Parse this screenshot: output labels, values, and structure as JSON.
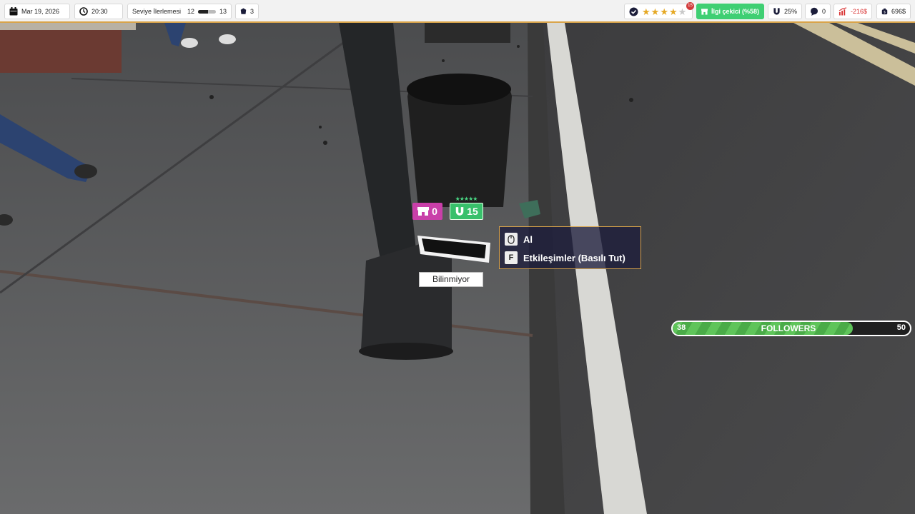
{
  "hud": {
    "date": "Mar 19, 2026",
    "time": "20:30",
    "level_label": "Seviye İlerlemesi",
    "level_current": "12",
    "level_next": "13",
    "level_progress": 0.55,
    "store_count": "3",
    "rating_stars": 4,
    "rating_max": 5,
    "rating_badge": "15",
    "appeal_label": "İlgi çekici (%58)",
    "magnet_pct": "25%",
    "bubble_count": "0",
    "trend_value": "-216$",
    "money": "696$",
    "colors": {
      "accent_gold": "#d9a44a",
      "appeal_green": "#3fcf73",
      "negative": "#d83030"
    }
  },
  "world": {
    "pink_tag_value": "0",
    "green_tag_value": "15",
    "green_tag_stars": "★★★★★",
    "item_label": "Bilinmiyor",
    "prompt": {
      "primary_key_icon": "mouse-icon",
      "primary_action": "Al",
      "secondary_key": "F",
      "secondary_action": "Etkileşimler (Basılı Tut)"
    }
  },
  "followers": {
    "label": "FOLLOWERS",
    "current": "38",
    "target": "50",
    "progress": 0.76,
    "color": "#5fc45a"
  }
}
